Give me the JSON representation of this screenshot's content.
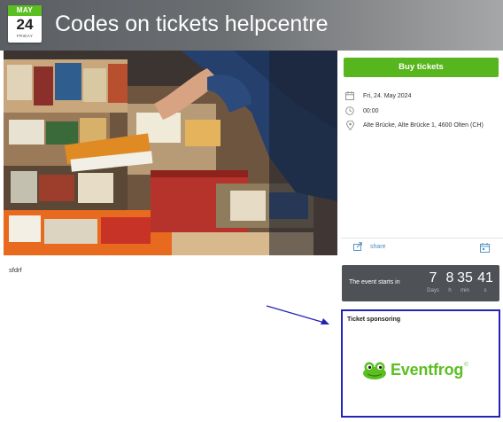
{
  "header": {
    "title": "Codes on tickets helpcentre",
    "date_badge": {
      "month": "MAY",
      "day": "24",
      "weekday": "FRIDAY"
    }
  },
  "event": {
    "buy_label": "Buy tickets",
    "date": "Fri, 24. May 2024",
    "time": "00:00",
    "location": "Alte Brücke, Alte Brücke 1, 4600 Olten (CH)",
    "share_label": "share",
    "description": "sfdrf"
  },
  "countdown": {
    "label": "The event starts in",
    "units": [
      {
        "value": "7",
        "label": "Days"
      },
      {
        "value": "8",
        "label": "h"
      },
      {
        "value": "35",
        "label": "min"
      },
      {
        "value": "41",
        "label": "s"
      }
    ]
  },
  "sponsor": {
    "title": "Ticket sponsoring",
    "logo_text": "Eventfrog",
    "logo_mark": "©"
  },
  "colors": {
    "brand_green": "#5bbf21",
    "annotation_blue": "#2323b8",
    "countdown_bg": "#4e5257"
  },
  "icons": [
    "calendar-icon",
    "clock-icon",
    "map-pin-icon",
    "share-icon",
    "calendar-add-icon",
    "frog-logo-icon",
    "annotation-arrow"
  ]
}
